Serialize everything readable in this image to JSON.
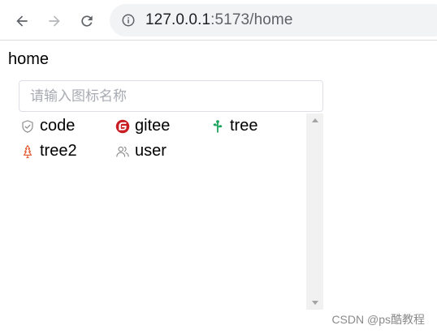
{
  "browser": {
    "url_host": "127.0.0.1",
    "url_rest": ":5173/home",
    "icons": {
      "back": "arrow-left-icon",
      "forward": "arrow-right-icon",
      "reload": "reload-icon",
      "site_info": "info-circle-icon"
    }
  },
  "page": {
    "heading": "home"
  },
  "icon_picker": {
    "search_placeholder": "请输入图标名称",
    "items": [
      {
        "label": "code",
        "icon": "shield-check-icon",
        "color": "#8c8c8c"
      },
      {
        "label": "gitee",
        "icon": "gitee-icon",
        "color": "#c71d23"
      },
      {
        "label": "tree",
        "icon": "tree-icon",
        "color": "#1aa35c"
      },
      {
        "label": "tree2",
        "icon": "tree2-icon",
        "color": "#e4572e"
      },
      {
        "label": "user",
        "icon": "user-group-icon",
        "color": "#8c8c8c"
      }
    ]
  },
  "watermark": "CSDN @ps酷教程"
}
